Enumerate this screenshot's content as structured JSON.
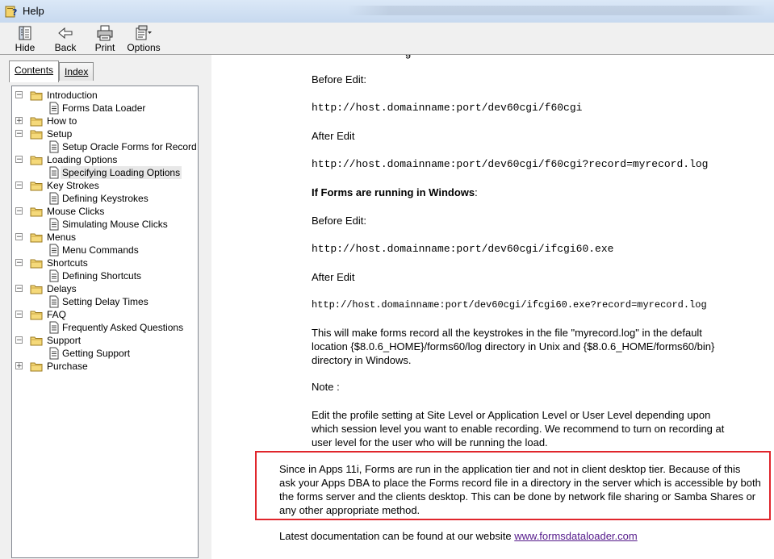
{
  "window": {
    "title": "Help"
  },
  "toolbar": {
    "hide": {
      "label": "Hide",
      "accel": "H"
    },
    "back": {
      "label": "Back",
      "accel": "B"
    },
    "print": {
      "label": "Print",
      "accel": "P"
    },
    "options": {
      "label": "Options",
      "accel": "O"
    }
  },
  "tabs": [
    {
      "label": "Contents",
      "active": true
    },
    {
      "label": "Index",
      "active": false
    }
  ],
  "tree": [
    {
      "type": "folder",
      "label": "Introduction",
      "expanded": true
    },
    {
      "type": "page",
      "label": "Forms Data Loader"
    },
    {
      "type": "folder",
      "label": "How to",
      "expanded": false
    },
    {
      "type": "folder",
      "label": "Setup",
      "expanded": true
    },
    {
      "type": "page",
      "label": "Setup Oracle Forms for Record & P"
    },
    {
      "type": "folder",
      "label": "Loading Options",
      "expanded": true
    },
    {
      "type": "page",
      "label": "Specifying Loading Options",
      "selected": true
    },
    {
      "type": "folder",
      "label": "Key Strokes",
      "expanded": true
    },
    {
      "type": "page",
      "label": "Defining Keystrokes"
    },
    {
      "type": "folder",
      "label": "Mouse Clicks",
      "expanded": true
    },
    {
      "type": "page",
      "label": "Simulating Mouse Clicks"
    },
    {
      "type": "folder",
      "label": "Menus",
      "expanded": true
    },
    {
      "type": "page",
      "label": "Menu Commands"
    },
    {
      "type": "folder",
      "label": "Shortcuts",
      "expanded": true
    },
    {
      "type": "page",
      "label": "Defining Shortcuts"
    },
    {
      "type": "folder",
      "label": "Delays",
      "expanded": true
    },
    {
      "type": "page",
      "label": "Setting Delay Times"
    },
    {
      "type": "folder",
      "label": "FAQ",
      "expanded": true
    },
    {
      "type": "page",
      "label": "Frequently Asked Questions"
    },
    {
      "type": "folder",
      "label": "Support",
      "expanded": true
    },
    {
      "type": "page",
      "label": "Getting Support"
    },
    {
      "type": "folder",
      "label": "Purchase",
      "expanded": false
    }
  ],
  "content": {
    "before_edit_1": "Before Edit:",
    "url_before_1": "http://host.domainname:port/dev60cgi/f60cgi",
    "after_edit_1": "After Edit",
    "url_after_1": "http://host.domainname:port/dev60cgi/f60cgi?record=myrecord.log",
    "windows_heading": "If Forms are running in Windows",
    "windows_colon": ":",
    "before_edit_2": "Before Edit:",
    "url_before_2": "http://host.domainname:port/dev60cgi/ifcgi60.exe",
    "after_edit_2": "After Edit",
    "url_after_2": "http://host.domainname:port/dev60cgi/ifcgi60.exe?record=myrecord.log",
    "para_record": [
      "This will make forms record all the keystrokes in the file \"myrecord.log\" in the default",
      "location {$8.0.6_HOME}/forms60/log directory in Unix and {$8.0.6_HOME/forms60/bin}",
      "directory in Windows."
    ],
    "note": "Note :",
    "para_profile": [
      "Edit the profile setting at Site Level or Application Level or User Level depending upon",
      "which session level you want to enable recording. We recommend to turn on recording at",
      "user level for the user who will be running the load."
    ],
    "para_apps": [
      "Since in Apps 11i,  Forms are run in the application tier and not in client desktop tier. Because of this",
      "ask your Apps DBA to place the Forms record file in a directory in the server which is accessible by both",
      "the forms server and the clients desktop. This can be done by network file sharing or Samba Shares or",
      "any other appropriate method."
    ],
    "latest_doc_text": "Latest documentation can be found at our website ",
    "latest_doc_link": "www.formsdataloader.com"
  }
}
